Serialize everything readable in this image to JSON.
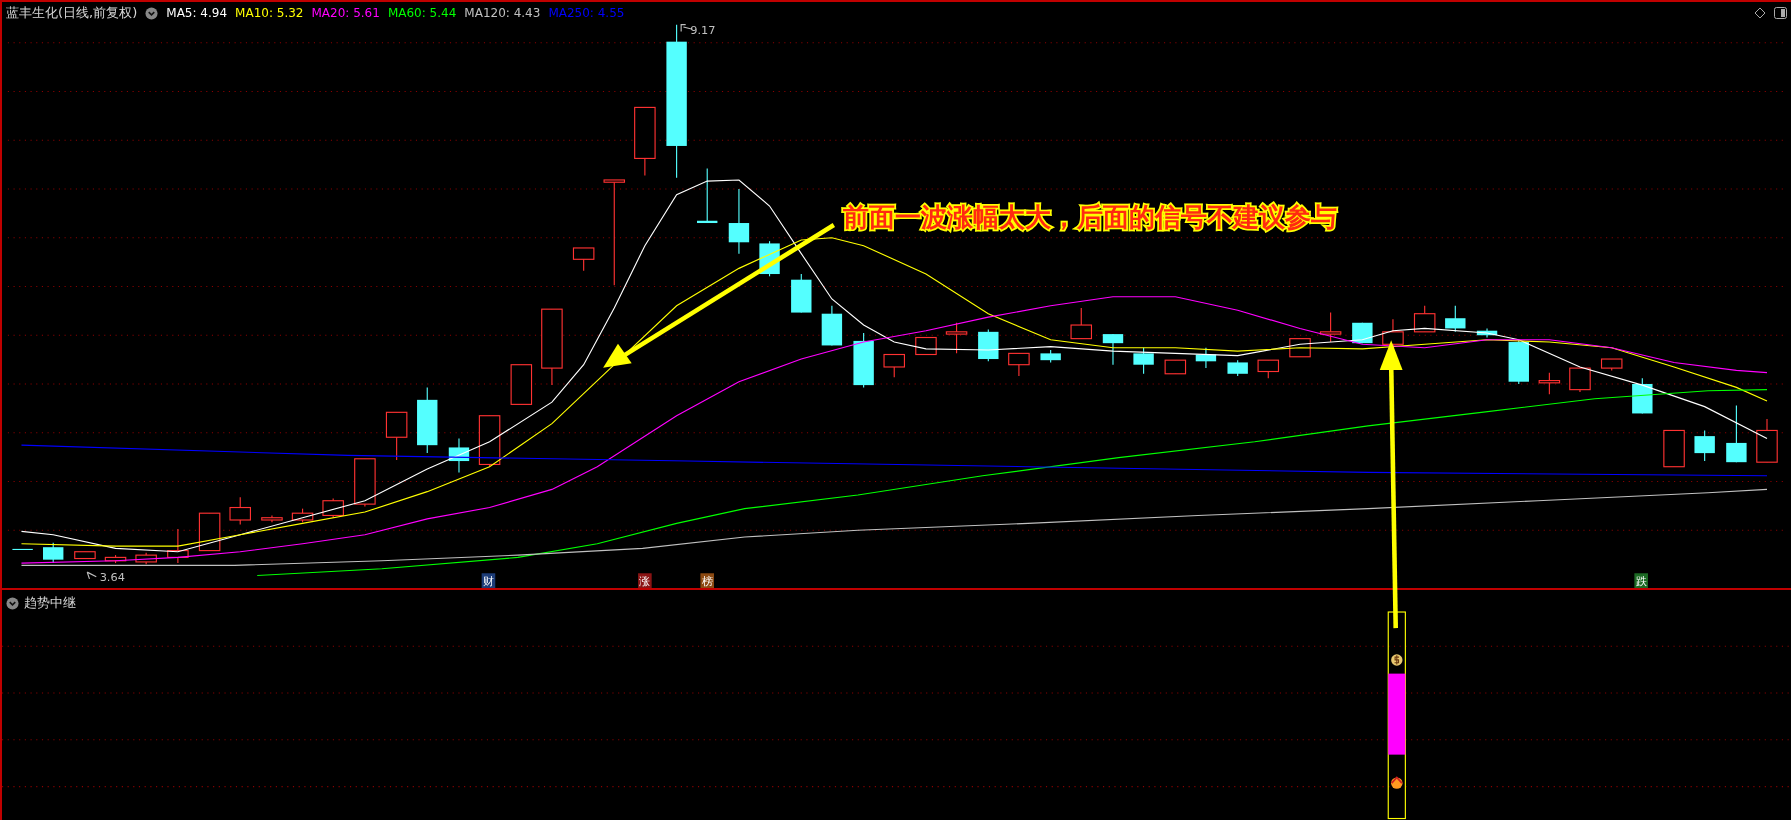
{
  "chart_title": "蓝丰生化(日线,前复权)",
  "ma_legend": [
    {
      "label": "MA5: 4.94",
      "color": "#ffffff"
    },
    {
      "label": "MA10: 5.32",
      "color": "#ffff00"
    },
    {
      "label": "MA20: 5.61",
      "color": "#ff00ff"
    },
    {
      "label": "MA60: 5.44",
      "color": "#00ff00"
    },
    {
      "label": "MA120: 4.43",
      "color": "#c0c0c0"
    },
    {
      "label": "MA250: 4.55",
      "color": "#0000ff"
    }
  ],
  "price_labels": [
    {
      "text": "9.17",
      "kind": "high"
    },
    {
      "text": "3.64",
      "kind": "low"
    }
  ],
  "signal_markers": [
    {
      "text": "财",
      "color": "#1c3c78"
    },
    {
      "text": "涨",
      "color": "#8a1414"
    },
    {
      "text": "榜",
      "color": "#8c4a12"
    },
    {
      "text": "跌",
      "color": "#1c6a24"
    }
  ],
  "annotation": "前面一波涨幅太大，后面的信号不建议参与",
  "indicator_panel": {
    "title": "趋势中继"
  }
}
